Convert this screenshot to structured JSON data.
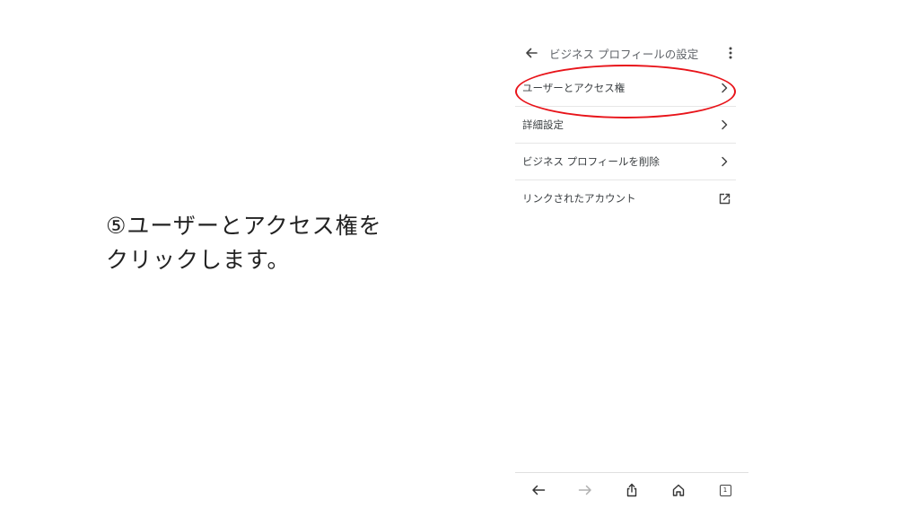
{
  "instruction": {
    "line1": "⑤ユーザーとアクセス権を",
    "line2": "クリックします。"
  },
  "appbar": {
    "title": "ビジネス プロフィールの設定",
    "back_icon": "arrow-left-icon",
    "more_icon": "more-vertical-icon"
  },
  "menu": {
    "items": [
      {
        "label": "ユーザーとアクセス権",
        "icon": "chevron-right-icon"
      },
      {
        "label": "詳細設定",
        "icon": "chevron-right-icon"
      },
      {
        "label": "ビジネス プロフィールを削除",
        "icon": "chevron-right-icon"
      },
      {
        "label": "リンクされたアカウント",
        "icon": "open-in-new-icon"
      }
    ]
  },
  "bottombar": {
    "tab_count": "1",
    "icons": [
      "back-icon",
      "forward-icon",
      "share-icon",
      "home-icon",
      "tabs-icon"
    ]
  },
  "colors": {
    "highlight": "#e8141a",
    "text": "#3c4043",
    "divider": "#e6e6e6"
  }
}
